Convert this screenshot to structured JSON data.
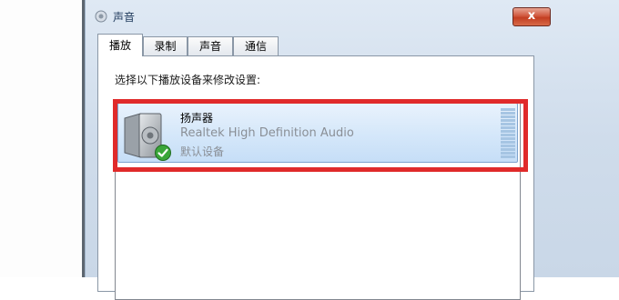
{
  "window": {
    "title": "声音",
    "close_label": "x"
  },
  "tabs": [
    {
      "label": "播放",
      "active": true
    },
    {
      "label": "录制",
      "active": false
    },
    {
      "label": "声音",
      "active": false
    },
    {
      "label": "通信",
      "active": false
    }
  ],
  "playback": {
    "instruction": "选择以下播放设备来修改设置:",
    "devices": [
      {
        "name": "扬声器",
        "description": "Realtek High Definition Audio",
        "status": "默认设备",
        "icon": "speaker-icon",
        "badge": "check-icon",
        "selected": true
      }
    ]
  },
  "colors": {
    "highlight": "#e02a2a",
    "selection": "#c6def7",
    "close_button": "#c33e22"
  }
}
